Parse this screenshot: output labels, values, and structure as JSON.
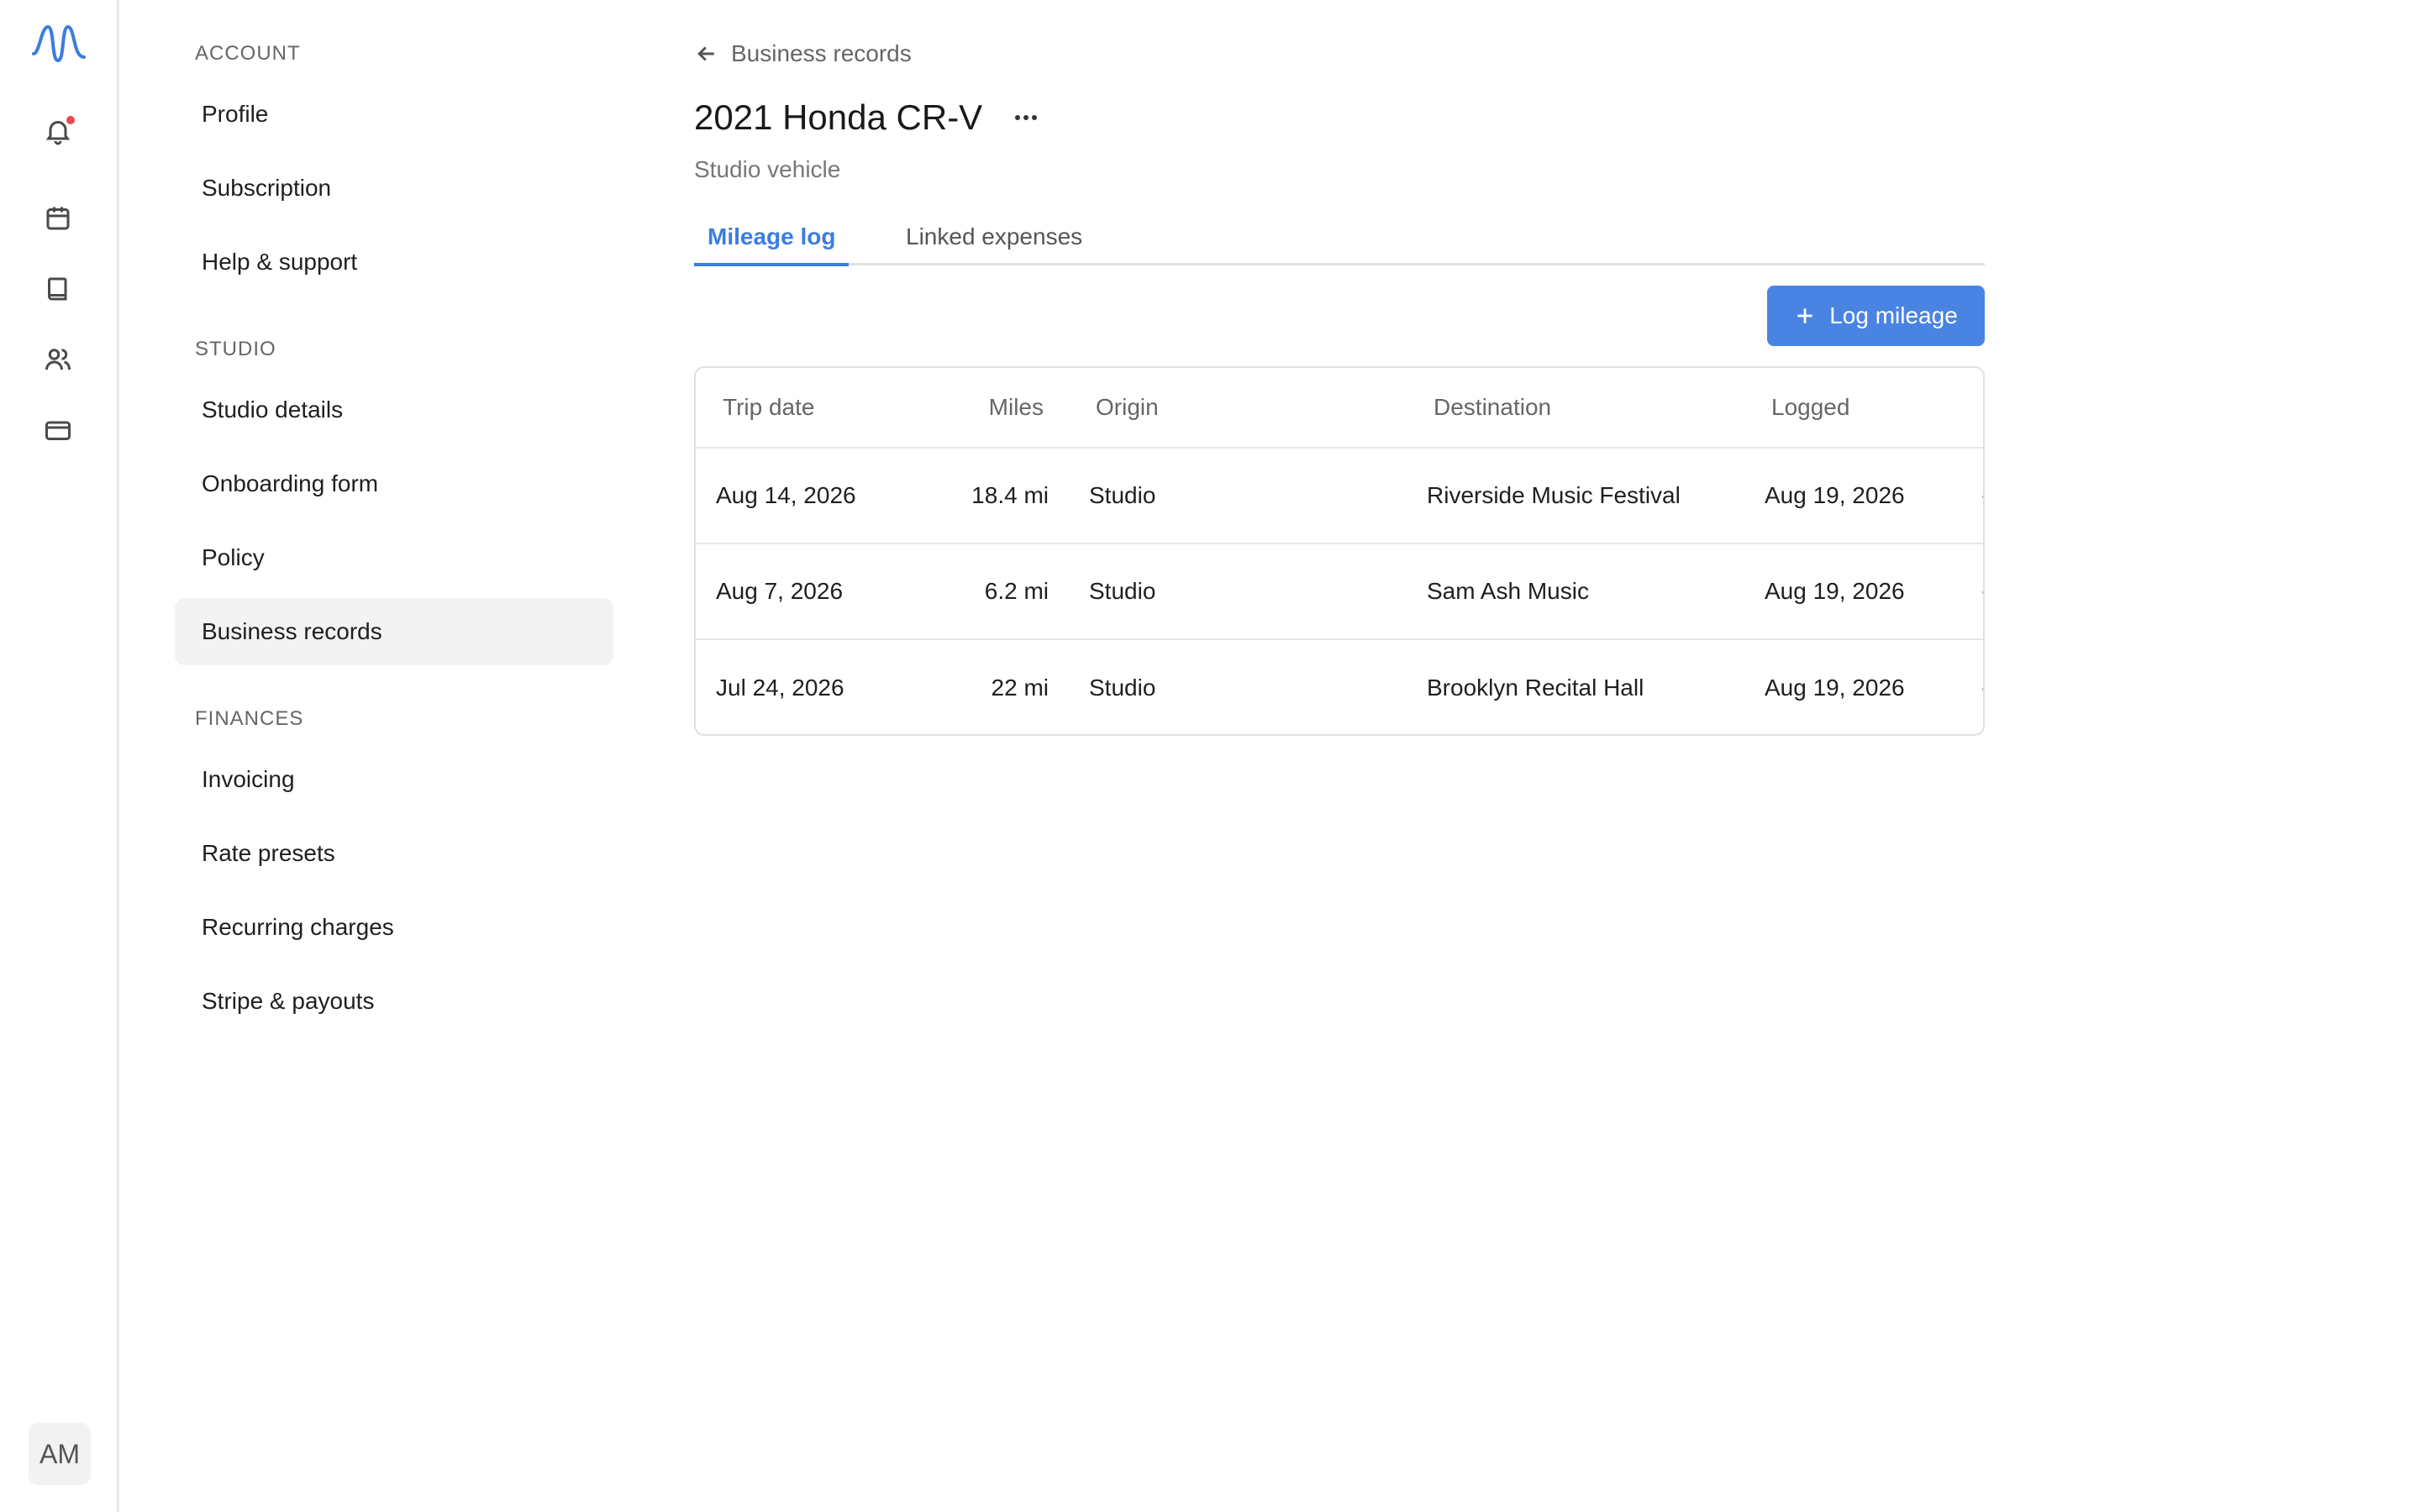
{
  "rail": {
    "icons": [
      "logo-icon",
      "bell-icon",
      "calendar-icon",
      "book-icon",
      "users-icon",
      "credit-card-icon"
    ],
    "avatar_initials": "AM",
    "accent_color": "#3b7de0",
    "notification_dot_color": "#e5484d"
  },
  "sidebar": {
    "sections": [
      {
        "label": "ACCOUNT",
        "items": [
          "Profile",
          "Subscription",
          "Help & support"
        ]
      },
      {
        "label": "STUDIO",
        "items": [
          "Studio details",
          "Onboarding form",
          "Policy",
          "Business records"
        ]
      },
      {
        "label": "FINANCES",
        "items": [
          "Invoicing",
          "Rate presets",
          "Recurring charges",
          "Stripe & payouts"
        ]
      }
    ],
    "active_item": "Business records"
  },
  "header": {
    "back_label": "Business records",
    "title": "2021 Honda CR-V",
    "subtitle": "Studio vehicle"
  },
  "tabs": [
    {
      "label": "Mileage log",
      "active": true
    },
    {
      "label": "Linked expenses",
      "active": false
    }
  ],
  "actions": {
    "log_mileage_label": "Log mileage"
  },
  "table": {
    "columns": [
      "Trip date",
      "Miles",
      "Origin",
      "Destination",
      "Logged"
    ],
    "rows": [
      {
        "trip_date": "Aug 14, 2026",
        "miles": "18.4 mi",
        "origin": "Studio",
        "destination": "Riverside Music Festival",
        "logged": "Aug 19, 2026"
      },
      {
        "trip_date": "Aug 7, 2026",
        "miles": "6.2 mi",
        "origin": "Studio",
        "destination": "Sam Ash Music",
        "logged": "Aug 19, 2026"
      },
      {
        "trip_date": "Jul 24, 2026",
        "miles": "22 mi",
        "origin": "Studio",
        "destination": "Brooklyn Recital Hall",
        "logged": "Aug 19, 2026"
      }
    ]
  }
}
